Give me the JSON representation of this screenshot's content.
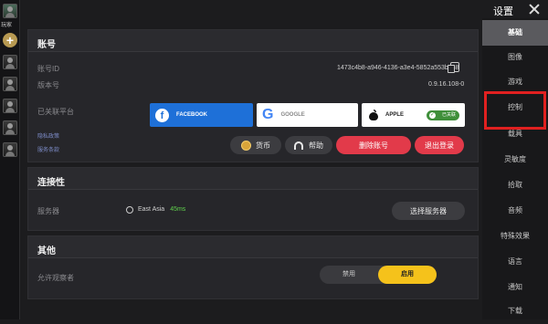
{
  "window": {
    "title": "设置"
  },
  "left_strip": {
    "self_name": "玩家"
  },
  "account": {
    "section_title": "账号",
    "account_id_label": "账号ID",
    "account_id_value": "1473c4b8-a946-4136-a3e4-5852a553be88",
    "version_label": "版本号",
    "version_value": "0.9.16.108-0",
    "linked_label": "已关联平台",
    "link_privacy": "隐私政策",
    "link_terms": "服务条款",
    "platforms": {
      "facebook": "FACEBOOK",
      "google": "GOOGLE",
      "apple": "APPLE",
      "linked_badge": "已关联"
    },
    "buttons": {
      "coins": "货币",
      "help": "帮助",
      "delete_account": "删除账号",
      "logout": "退出登录"
    }
  },
  "connectivity": {
    "section_title": "连接性",
    "server_label": "服务器",
    "server_name": "East Asia",
    "ping": "45ms",
    "select_server": "选择服务器"
  },
  "other": {
    "section_title": "其他",
    "allow_label": "允许观察者",
    "toggle_off": "禁用",
    "toggle_on": "启用",
    "toggle_state": "on"
  },
  "tabs": [
    {
      "label": "基础",
      "active": true
    },
    {
      "label": "图像"
    },
    {
      "label": "游戏"
    },
    {
      "label": "控制"
    },
    {
      "label": "载具"
    },
    {
      "label": "灵敏度"
    },
    {
      "label": "拾取"
    },
    {
      "label": "音频"
    },
    {
      "label": "特殊效果"
    },
    {
      "label": "语言"
    },
    {
      "label": "通知"
    },
    {
      "label": "下载"
    }
  ],
  "colors": {
    "accent_red": "#e23a4a",
    "toggle_yellow": "#f5c21b",
    "facebook_blue": "#1e70d8",
    "ping_green": "#5fd04c",
    "highlight_red": "#e02020"
  }
}
